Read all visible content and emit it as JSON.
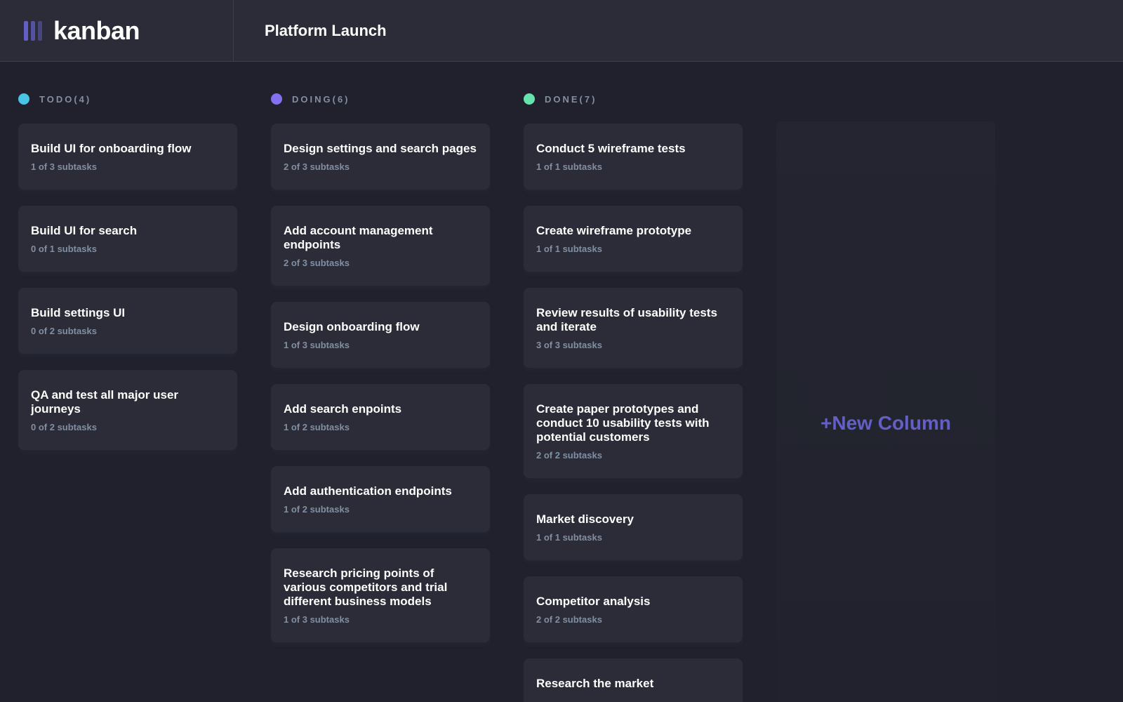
{
  "app": {
    "brand": "kanban",
    "board_title": "Platform Launch",
    "accent": "#635fc7"
  },
  "columns": [
    {
      "title": "TODO(4)",
      "color": "#49c4e5",
      "cards": [
        {
          "title": "Build UI for onboarding flow",
          "subtasks": "1 of 3 subtasks"
        },
        {
          "title": "Build UI for search",
          "subtasks": "0 of 1 subtasks"
        },
        {
          "title": "Build settings UI",
          "subtasks": "0 of 2 subtasks"
        },
        {
          "title": "QA and test all major user journeys",
          "subtasks": "0 of 2 subtasks"
        }
      ]
    },
    {
      "title": "DOING(6)",
      "color": "#8471f2",
      "cards": [
        {
          "title": "Design settings and search pages",
          "subtasks": "2 of 3 subtasks"
        },
        {
          "title": "Add account management endpoints",
          "subtasks": "2 of 3 subtasks"
        },
        {
          "title": "Design onboarding flow",
          "subtasks": "1 of 3 subtasks"
        },
        {
          "title": "Add search enpoints",
          "subtasks": "1 of 2 subtasks"
        },
        {
          "title": "Add authentication endpoints",
          "subtasks": "1 of 2 subtasks"
        },
        {
          "title": "Research pricing points of various competitors and trial different business models",
          "subtasks": "1 of 3 subtasks"
        }
      ]
    },
    {
      "title": "DONE(7)",
      "color": "#67e2ae",
      "cards": [
        {
          "title": "Conduct 5 wireframe tests",
          "subtasks": "1 of 1 subtasks"
        },
        {
          "title": "Create wireframe prototype",
          "subtasks": "1 of 1 subtasks"
        },
        {
          "title": "Review results of usability tests and iterate",
          "subtasks": "3 of 3 subtasks"
        },
        {
          "title": "Create paper prototypes and conduct 10 usability tests with potential customers",
          "subtasks": "2 of 2 subtasks"
        },
        {
          "title": "Market discovery",
          "subtasks": "1 of 1 subtasks"
        },
        {
          "title": "Competitor analysis",
          "subtasks": "2 of 2 subtasks"
        },
        {
          "title": "Research the market",
          "subtasks": ""
        }
      ]
    }
  ],
  "new_column_label": "+New Column"
}
